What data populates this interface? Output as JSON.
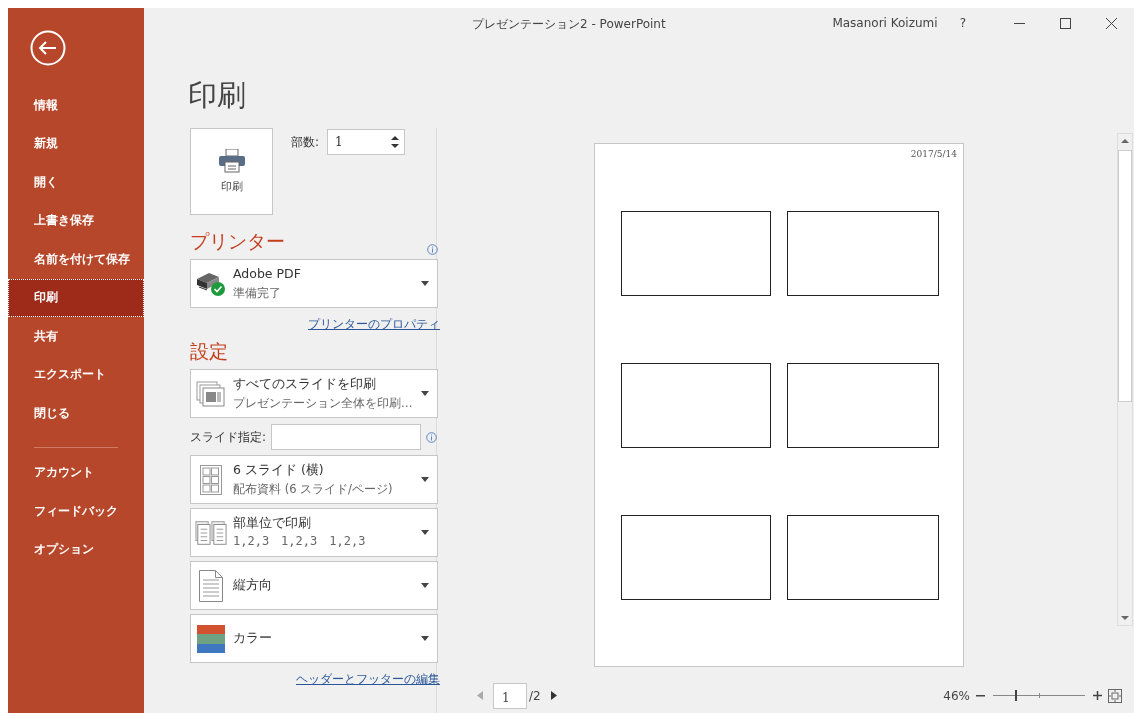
{
  "window": {
    "title": "プレゼンテーション2 - PowerPoint",
    "user": "Masanori Koizumi",
    "help": "?"
  },
  "sidebar": {
    "items": [
      {
        "label": "情報",
        "selected": false
      },
      {
        "label": "新規",
        "selected": false
      },
      {
        "label": "開く",
        "selected": false
      },
      {
        "label": "上書き保存",
        "selected": false
      },
      {
        "label": "名前を付けて保存",
        "selected": false
      },
      {
        "label": "印刷",
        "selected": true
      },
      {
        "label": "共有",
        "selected": false
      },
      {
        "label": "エクスポート",
        "selected": false
      },
      {
        "label": "閉じる",
        "selected": false
      }
    ],
    "footer_items": [
      {
        "label": "アカウント",
        "selected": false
      },
      {
        "label": "フィードバック",
        "selected": false
      },
      {
        "label": "オプション",
        "selected": false
      }
    ]
  },
  "heading": "印刷",
  "print_button": {
    "label": "印刷"
  },
  "copies": {
    "label": "部数:",
    "value": "1"
  },
  "printer": {
    "heading": "プリンター",
    "name": "Adobe PDF",
    "status": "準備完了",
    "properties_link": "プリンターのプロパティ"
  },
  "settings": {
    "heading": "設定",
    "rows": [
      {
        "kind": "slides",
        "title": "すべてのスライドを印刷",
        "subtitle": "プレゼンテーション全体を印刷…"
      },
      {
        "kind": "range",
        "label": "スライド指定:"
      },
      {
        "kind": "layout",
        "title": "6 スライド (横)",
        "subtitle": "配布資料 (6 スライド/ページ)"
      },
      {
        "kind": "collate",
        "title": "部単位で印刷",
        "subtitle": "1,2,3　1,2,3　1,2,3"
      },
      {
        "kind": "orientation",
        "title": "縦方向"
      },
      {
        "kind": "color",
        "title": "カラー"
      }
    ],
    "header_footer_link": "ヘッダーとフッターの編集"
  },
  "preview": {
    "date": "2017/5/14"
  },
  "page_nav": {
    "page": "1",
    "total": "/2"
  },
  "zoom": {
    "reading": "46%",
    "level": 0.24
  }
}
